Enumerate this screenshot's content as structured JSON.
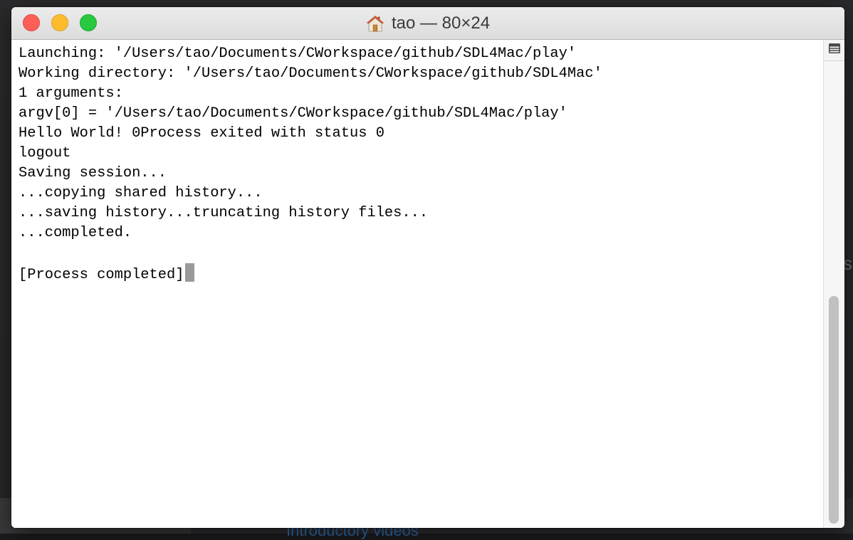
{
  "window": {
    "title": "tao — 80×24",
    "title_icon": "home-icon"
  },
  "traffic_lights": {
    "close_color": "#fc5f57",
    "minimize_color": "#fdbc2e",
    "zoom_color": "#28c840"
  },
  "terminal": {
    "lines": [
      "Launching: '/Users/tao/Documents/CWorkspace/github/SDL4Mac/play'",
      "Working directory: '/Users/tao/Documents/CWorkspace/github/SDL4Mac'",
      "1 arguments:",
      "argv[0] = '/Users/tao/Documents/CWorkspace/github/SDL4Mac/play'",
      "Hello World! 0Process exited with status 0",
      "logout",
      "Saving session...",
      "...copying shared history...",
      "...saving history...truncating history files...",
      "...completed.",
      "",
      "[Process completed]"
    ],
    "cursor_color": "#9a9a9a"
  },
  "background": {
    "link_text": "Introductory videos",
    "side_letter": "s"
  }
}
